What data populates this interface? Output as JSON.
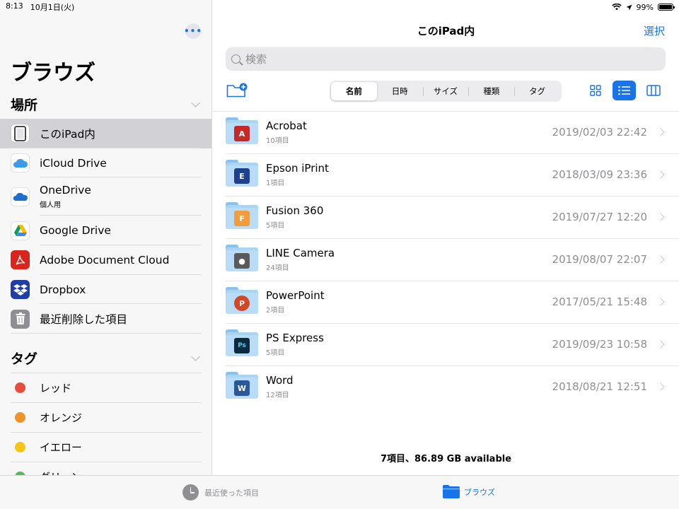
{
  "status_bar": {
    "time": "8:13",
    "date": "10月1日(火)",
    "battery": "99%"
  },
  "sidebar": {
    "title": "ブラウズ",
    "locations_header": "場所",
    "locations": [
      {
        "label": "このiPad内",
        "sub": "",
        "icon": "ipad-icon",
        "selected": true
      },
      {
        "label": "iCloud Drive",
        "sub": "",
        "icon": "icloud-icon"
      },
      {
        "label": "OneDrive",
        "sub": "個人用",
        "icon": "onedrive-icon"
      },
      {
        "label": "Google Drive",
        "sub": "",
        "icon": "google-drive-icon"
      },
      {
        "label": "Adobe Document Cloud",
        "sub": "",
        "icon": "adobe-icon"
      },
      {
        "label": "Dropbox",
        "sub": "",
        "icon": "dropbox-icon"
      },
      {
        "label": "最近削除した項目",
        "sub": "",
        "icon": "trash-icon"
      }
    ],
    "tags_header": "タグ",
    "tags": [
      {
        "label": "レッド",
        "color": "#e74c3c"
      },
      {
        "label": "オレンジ",
        "color": "#f0932b"
      },
      {
        "label": "イエロー",
        "color": "#f5c518"
      },
      {
        "label": "グリーン",
        "color": "#5cb85c"
      }
    ]
  },
  "main": {
    "title": "このiPad内",
    "select_label": "選択",
    "search_placeholder": "検索",
    "sort_tabs": [
      "名前",
      "日時",
      "サイズ",
      "種類",
      "タグ"
    ],
    "active_sort": "名前",
    "files": [
      {
        "name": "Acrobat",
        "count": "10項目",
        "date": "2019/02/03 22:42",
        "app": "acrobat",
        "badge_color": "#c62828",
        "badge_text": "A"
      },
      {
        "name": "Epson iPrint",
        "count": "1項目",
        "date": "2018/03/09 23:36",
        "app": "epson",
        "badge_color": "#1f3f8f",
        "badge_text": "E"
      },
      {
        "name": "Fusion 360",
        "count": "5項目",
        "date": "2019/07/27 12:20",
        "app": "fusion",
        "badge_color": "#f39c3c",
        "badge_text": "F"
      },
      {
        "name": "LINE Camera",
        "count": "24項目",
        "date": "2019/08/07 22:07",
        "app": "line-camera",
        "badge_color": "#5a5a5a",
        "badge_text": "●"
      },
      {
        "name": "PowerPoint",
        "count": "2項目",
        "date": "2017/05/21 15:48",
        "app": "powerpoint",
        "badge_color": "#d24726",
        "badge_text": "P"
      },
      {
        "name": "PS Express",
        "count": "5項目",
        "date": "2019/09/23 10:58",
        "app": "ps-express",
        "badge_color": "#0b2a3c",
        "badge_text": "Ps"
      },
      {
        "name": "Word",
        "count": "12項目",
        "date": "2018/08/21 12:51",
        "app": "word",
        "badge_color": "#2b579a",
        "badge_text": "W"
      }
    ],
    "storage": "7項目、86.89 GB available"
  },
  "tabbar": {
    "recent_label": "最近使った項目",
    "browse_label": "ブラウズ"
  },
  "colors": {
    "accent": "#1a73e8",
    "selected_row": "#d1d1d6",
    "folder": "#a9d5f5"
  }
}
